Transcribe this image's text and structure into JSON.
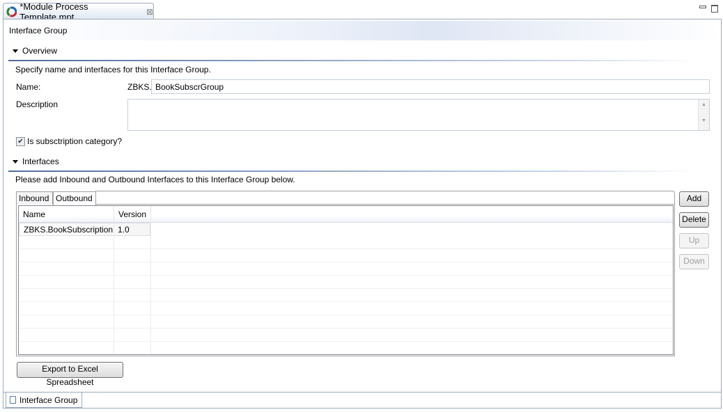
{
  "editor": {
    "tab_title": "*Module Process Template.mpt",
    "form_title": "Interface Group"
  },
  "overview": {
    "title": "Overview",
    "description": "Specify name and interfaces for this Interface Group.",
    "name_label": "Name:",
    "name_prefix": "ZBKS.",
    "name_value": "BookSubscrGroup",
    "description_label": "Description",
    "description_value": "",
    "subscription_label": "Is subsctription category?",
    "subscription_checked": true
  },
  "interfaces": {
    "title": "Interfaces",
    "description": "Please add Inbound and Outbound Interfaces to this Interface Group below.",
    "tabs": [
      "Inbound",
      "Outbound"
    ],
    "active_tab": "Outbound",
    "columns": [
      "Name",
      "Version"
    ],
    "rows": [
      {
        "name": "ZBKS.BookSubscription",
        "version": "1.0"
      }
    ],
    "buttons": {
      "add": "Add",
      "delete": "Delete",
      "up": "Up",
      "down": "Down"
    },
    "export": "Export to Excel Spreadsheet"
  },
  "bottom_tab": "Interface Group"
}
